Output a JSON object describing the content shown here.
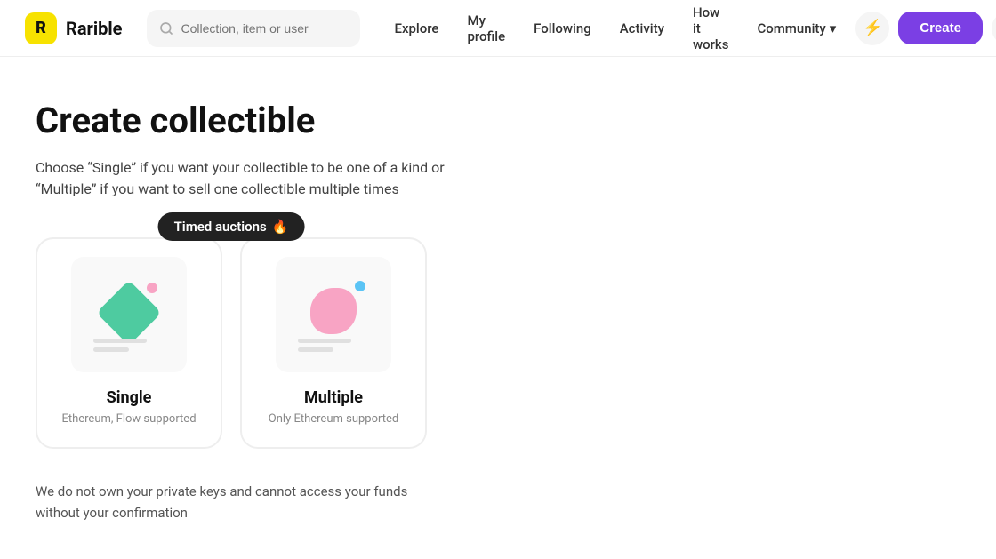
{
  "logo": {
    "icon": "R",
    "text": "Rarible"
  },
  "search": {
    "placeholder": "Collection, item or user"
  },
  "nav": {
    "explore": "Explore",
    "my_profile": "My profile",
    "following": "Following",
    "activity": "Activity",
    "how_it_works": "How it works",
    "community": "Community",
    "community_chevron": "▾",
    "create": "Create"
  },
  "page": {
    "title": "Create collectible",
    "description_line1": "Choose “Single” if you want your collectible to be one of a kind or",
    "description_line2": "“Multiple” if you want to sell one collectible multiple times"
  },
  "tooltip": {
    "text": "Timed auctions",
    "emoji": "🔥"
  },
  "cards": [
    {
      "id": "single",
      "title": "Single",
      "subtitle": "Ethereum, Flow supported"
    },
    {
      "id": "multiple",
      "title": "Multiple",
      "subtitle": "Only Ethereum supported"
    }
  ],
  "footer_note": {
    "line1": "We do not own your private keys and cannot access your funds",
    "line2": "without your confirmation"
  }
}
